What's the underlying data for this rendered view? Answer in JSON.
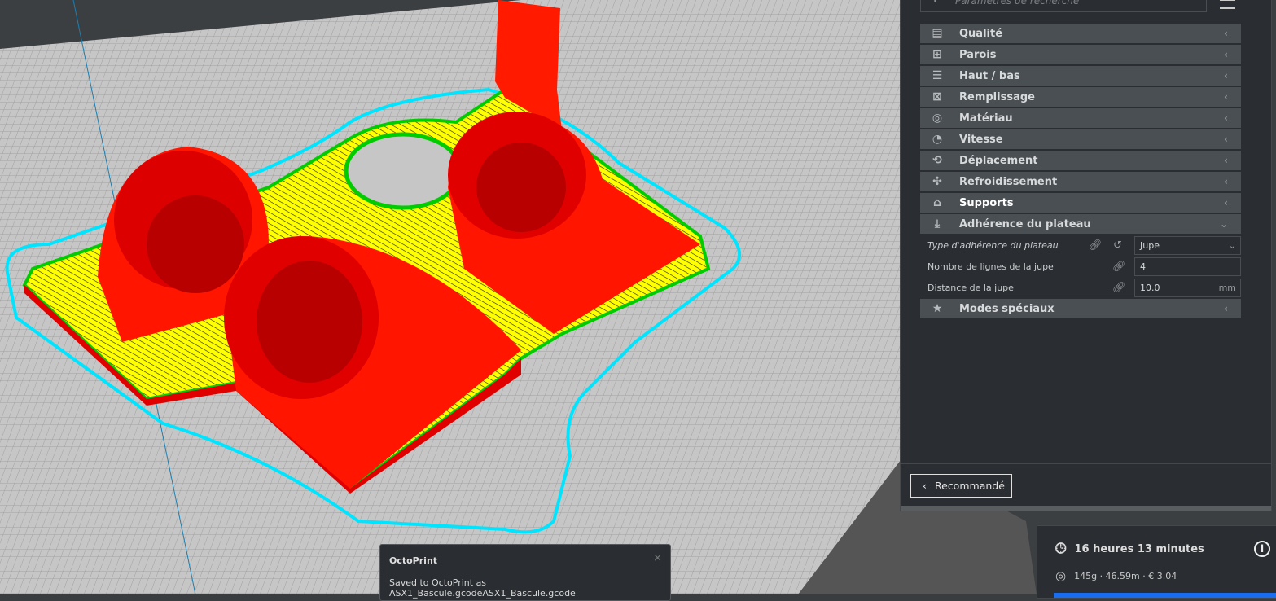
{
  "search": {
    "placeholder": "Paramètres de recherche"
  },
  "categories": [
    {
      "label": "Qualité",
      "icon": "quality-icon",
      "glyph": "▤"
    },
    {
      "label": "Parois",
      "icon": "walls-icon",
      "glyph": "⊞"
    },
    {
      "label": "Haut / bas",
      "icon": "top-bottom-icon",
      "glyph": "☰"
    },
    {
      "label": "Remplissage",
      "icon": "infill-icon",
      "glyph": "⊠"
    },
    {
      "label": "Matériau",
      "icon": "material-icon",
      "glyph": "◎"
    },
    {
      "label": "Vitesse",
      "icon": "speed-icon",
      "glyph": "◔"
    },
    {
      "label": "Déplacement",
      "icon": "travel-icon",
      "glyph": "⟲"
    },
    {
      "label": "Refroidissement",
      "icon": "fan-icon",
      "glyph": "✣"
    },
    {
      "label": "Supports",
      "icon": "supports-icon",
      "glyph": "⌂"
    },
    {
      "label": "Adhérence du plateau",
      "icon": "adhesion-icon",
      "glyph": "⤓"
    },
    {
      "label": "Modes spéciaux",
      "icon": "star-icon",
      "glyph": "★"
    }
  ],
  "adhesion_settings": [
    {
      "label": "Type d'adhérence du plateau",
      "value": "Jupe"
    },
    {
      "label": "Nombre de lignes de la jupe",
      "value": "4"
    },
    {
      "label": "Distance de la jupe",
      "value": "10.0",
      "unit": "mm"
    }
  ],
  "recommended_label": "Recommandé",
  "summary": {
    "time": "16 heures 13 minutes",
    "material": "145g · 46.59m · € 3.04"
  },
  "toast": {
    "title": "OctoPrint",
    "message": "Saved to OctoPrint as ASX1_Bascule.gcodeASX1_Bascule.gcode"
  },
  "colors": {
    "accent": "#196ef0",
    "wall": "#ff0000",
    "infill": "#ffff00",
    "inner_wall": "#00cc00",
    "skirt": "#00ffff"
  }
}
